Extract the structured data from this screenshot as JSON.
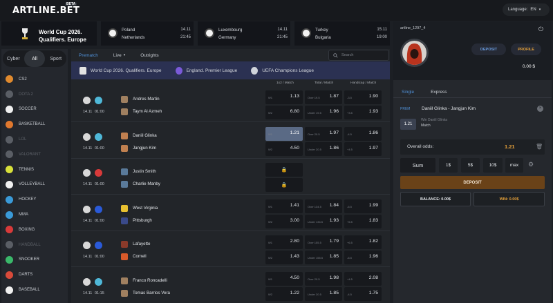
{
  "header": {
    "logo": "ARTLINE.BET",
    "beta": "BETA",
    "language_label": "Language:",
    "language_value": "EN"
  },
  "event_header": {
    "league_title": "World Cup 2026. Qualifiers. Europe",
    "matches": [
      {
        "team1": "Poland",
        "team2": "Netherlands",
        "date": "14.11",
        "time": "21:45"
      },
      {
        "team1": "Luxembourg",
        "team2": "Germany",
        "date": "14.11",
        "time": "21:45"
      },
      {
        "team1": "Turkey",
        "team2": "Bulgaria",
        "date": "15.11",
        "time": "19:00"
      }
    ]
  },
  "sidebar": {
    "tabs": [
      "Cyber",
      "All",
      "Sport"
    ],
    "active_tab": "All",
    "sports": [
      {
        "label": "CS2",
        "icon": "cs2-icon",
        "color": "#e08a2e",
        "dim": false
      },
      {
        "label": "DOTA 2",
        "icon": "dota2-icon",
        "color": "#5a5e65",
        "dim": true
      },
      {
        "label": "SOCCER",
        "icon": "soccer-icon",
        "color": "#f0f0f0",
        "dim": false
      },
      {
        "label": "BASKETBALL",
        "icon": "basketball-icon",
        "color": "#e0782e",
        "dim": false
      },
      {
        "label": "LOL",
        "icon": "lol-icon",
        "color": "#5a5e65",
        "dim": true
      },
      {
        "label": "VALORANT",
        "icon": "valorant-icon",
        "color": "#5a5e65",
        "dim": true
      },
      {
        "label": "TENNIS",
        "icon": "tennis-icon",
        "color": "#d8e03a",
        "dim": false
      },
      {
        "label": "VOLLEYBALL",
        "icon": "volleyball-icon",
        "color": "#f0f0f0",
        "dim": false
      },
      {
        "label": "HOCKEY",
        "icon": "hockey-icon",
        "color": "#3a9ad8",
        "dim": false
      },
      {
        "label": "MMA",
        "icon": "mma-icon",
        "color": "#3a9ad8",
        "dim": false
      },
      {
        "label": "BOXING",
        "icon": "boxing-icon",
        "color": "#d83a3a",
        "dim": false
      },
      {
        "label": "HANDBALL",
        "icon": "handball-icon",
        "color": "#5a5e65",
        "dim": true
      },
      {
        "label": "SNOOKER",
        "icon": "snooker-icon",
        "color": "#3ab86a",
        "dim": false
      },
      {
        "label": "DARTS",
        "icon": "darts-icon",
        "color": "#d84a3a",
        "dim": false
      },
      {
        "label": "BASEBALL",
        "icon": "baseball-icon",
        "color": "#f0f0f0",
        "dim": false
      }
    ]
  },
  "main": {
    "tabs": [
      "Prematch",
      "Live",
      "Outrights"
    ],
    "active_tab": "Prematch",
    "live_suffix": "▾",
    "search_placeholder": "Search",
    "leagues": [
      "World Cup 2026. Qualifiers. Europe",
      "England. Premier League",
      "UEFA Champions League"
    ],
    "col_heads": [
      "1x2 / Match",
      "Total / Match",
      "Handicap / Match"
    ],
    "matches": [
      {
        "team1": "Andres Martin",
        "team2": "Taym Al Azmeh",
        "date": "14.11",
        "time": "01:00",
        "w1": "1.13",
        "w2": "6.80",
        "over": "1.87",
        "under": "1.96",
        "over_lbl": "Over 19.5",
        "under_lbl": "Under 19.5",
        "h1": "1.90",
        "h2": "1.93",
        "h1_lbl": "-3.5",
        "h2_lbl": "+3.5",
        "locked": false,
        "selected": false
      },
      {
        "team1": "Daniil Glinka",
        "team2": "Jangjun Kim",
        "date": "14.11",
        "time": "01:00",
        "w1": "1.21",
        "w2": "4.50",
        "over": "1.97",
        "under": "1.86",
        "over_lbl": "Over 20.5",
        "under_lbl": "Under 20.5",
        "h1": "1.86",
        "h2": "1.97",
        "h1_lbl": "-4.5",
        "h2_lbl": "+4.5",
        "locked": false,
        "selected": true
      },
      {
        "team1": "Justin Smith",
        "team2": "Charlie Manby",
        "date": "14.11",
        "time": "01:00",
        "locked": true
      },
      {
        "team1": "West Virginia",
        "team2": "Pittsburgh",
        "date": "14.11",
        "time": "01:00",
        "w1": "1.41",
        "w2": "3.00",
        "over": "1.84",
        "under": "1.93",
        "over_lbl": "Over 134.5",
        "under_lbl": "Under 134.5",
        "h1": "1.99",
        "h2": "1.83",
        "h1_lbl": "-6.5",
        "h2_lbl": "+6.5",
        "locked": false,
        "selected": false
      },
      {
        "team1": "Lafayette",
        "team2": "Cornell",
        "date": "14.11",
        "time": "01:00",
        "w1": "2.80",
        "w2": "1.43",
        "over": "1.79",
        "under": "1.85",
        "over_lbl": "Over 155.5",
        "under_lbl": "Under 155.5",
        "h1": "1.82",
        "h2": "1.96",
        "h1_lbl": "+6.5",
        "h2_lbl": "-6.5",
        "locked": false,
        "selected": false
      },
      {
        "team1": "Franco Roncadelli",
        "team2": "Tomas Barrios Vera",
        "date": "14.11",
        "time": "01:15",
        "w1": "4.50",
        "w2": "1.22",
        "over": "1.98",
        "under": "1.85",
        "over_lbl": "Over 20.5",
        "under_lbl": "Under 20.5",
        "h1": "2.08",
        "h2": "1.75",
        "h1_lbl": "+4.5",
        "h2_lbl": "-4.5",
        "locked": false,
        "selected": false
      }
    ],
    "w1_lbl": "W1",
    "w2_lbl": "W2"
  },
  "account": {
    "username": "artline_1297_4",
    "deposit": "DEPOSIT",
    "profile": "PROFILE",
    "balance": "0.00 $"
  },
  "betslip": {
    "tabs": [
      "Single",
      "Express"
    ],
    "active_tab": "Single",
    "event_type": "PREM",
    "event": "Daniil Glinka - Jangjun Kim",
    "odd": "1.21",
    "pick": "Win Daniil Glinka",
    "market": "Match",
    "overall_label": "Overall odds:",
    "overall_value": "1.21",
    "sum_label": "Sum",
    "quick_amounts": [
      "1$",
      "5$",
      "10$",
      "max"
    ],
    "deposit_label": "DEPOSIT",
    "balance_label": "BALANCE: 0.00$",
    "win_label": "WIN: 0.00$"
  },
  "colors": {
    "accent_blue": "#4f8fd6",
    "accent_orange": "#e4a03a",
    "league_bar": "#2b3152",
    "deposit_bar": "#6a4218"
  }
}
